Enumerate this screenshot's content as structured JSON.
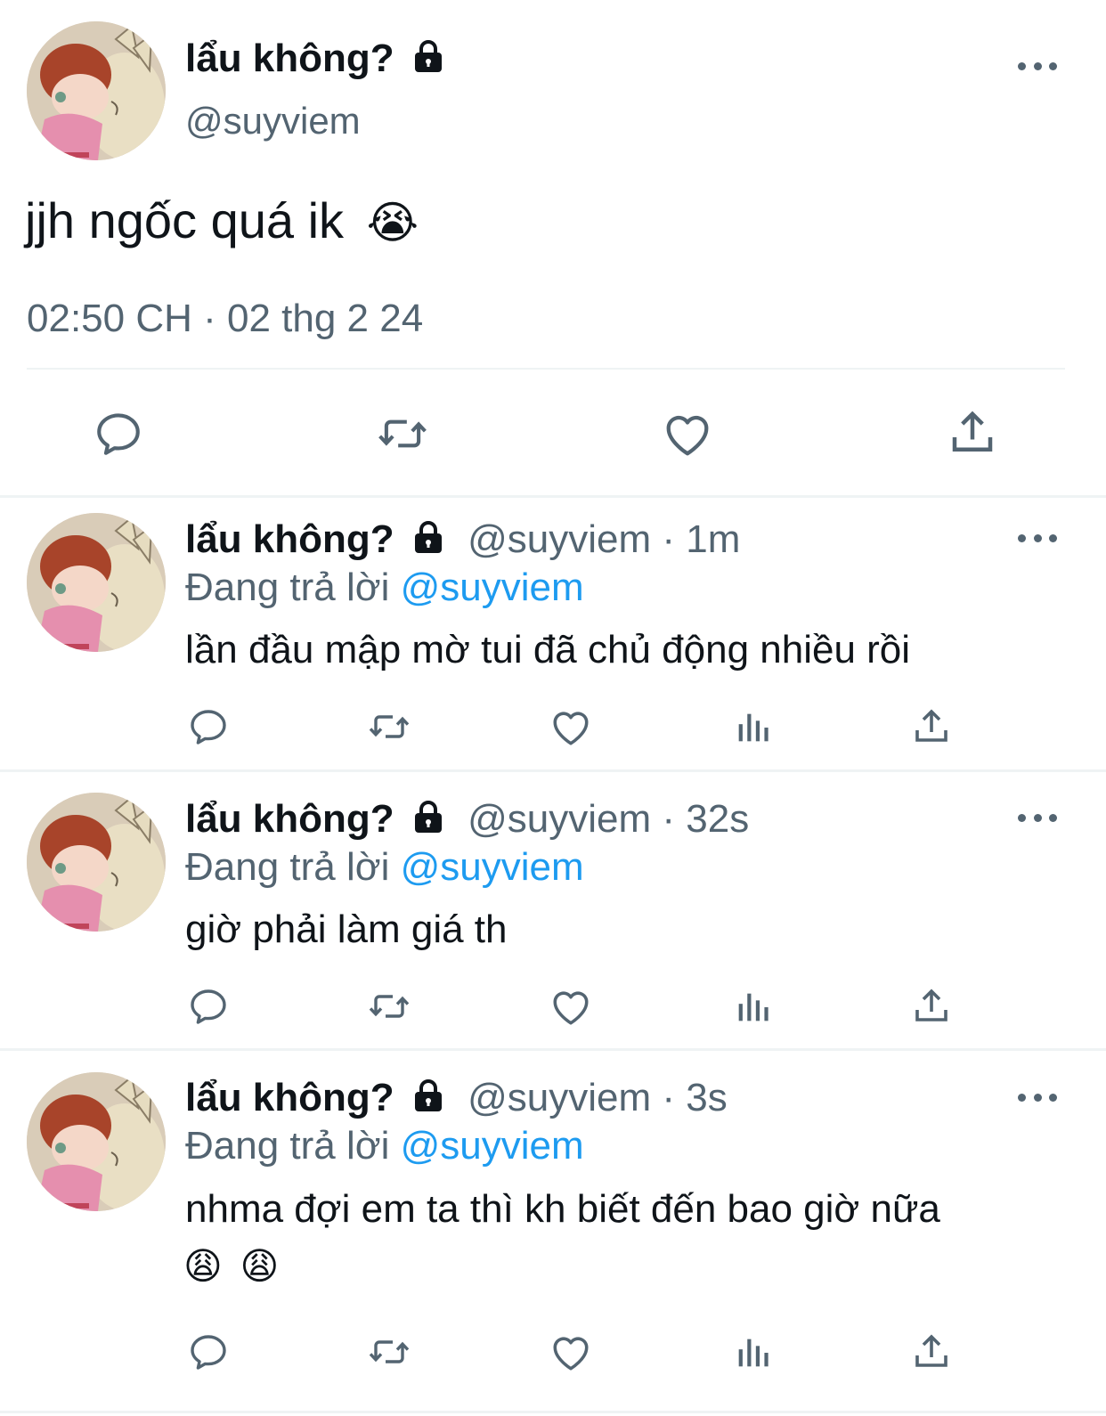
{
  "main_tweet": {
    "display_name": "lẩu không?",
    "handle": "@suyviem",
    "text": "jjh ngốc quá ik",
    "emoji": "😭",
    "timestamp": "02:50 CH · 02 thg 2 24"
  },
  "replies": [
    {
      "display_name": "lẩu không?",
      "handle_time": "@suyviem · 1m",
      "replying_prefix": "Đang trả lời",
      "replying_to": "@suyviem",
      "text": "lần đầu mập mờ tui đã chủ động nhiều rồi",
      "emoji_line": ""
    },
    {
      "display_name": "lẩu không?",
      "handle_time": "@suyviem · 32s",
      "replying_prefix": "Đang trả lời",
      "replying_to": "@suyviem",
      "text": "giờ phải làm giá th",
      "emoji_line": ""
    },
    {
      "display_name": "lẩu không?",
      "handle_time": "@suyviem · 3s",
      "replying_prefix": "Đang trả lời",
      "replying_to": "@suyviem",
      "text": "nhma đợi em ta thì kh biết đến bao giờ nữa",
      "emoji_line": "😩 😩"
    }
  ],
  "icons": {
    "reply": "reply-icon",
    "retweet": "retweet-icon",
    "like": "heart-icon",
    "views": "views-icon",
    "share": "share-icon",
    "more": "more-icon",
    "lock": "lock-icon"
  },
  "colors": {
    "text": "#0f1419",
    "secondary": "#536471",
    "accent": "#1d9bf0",
    "divider": "#eff3f4"
  }
}
